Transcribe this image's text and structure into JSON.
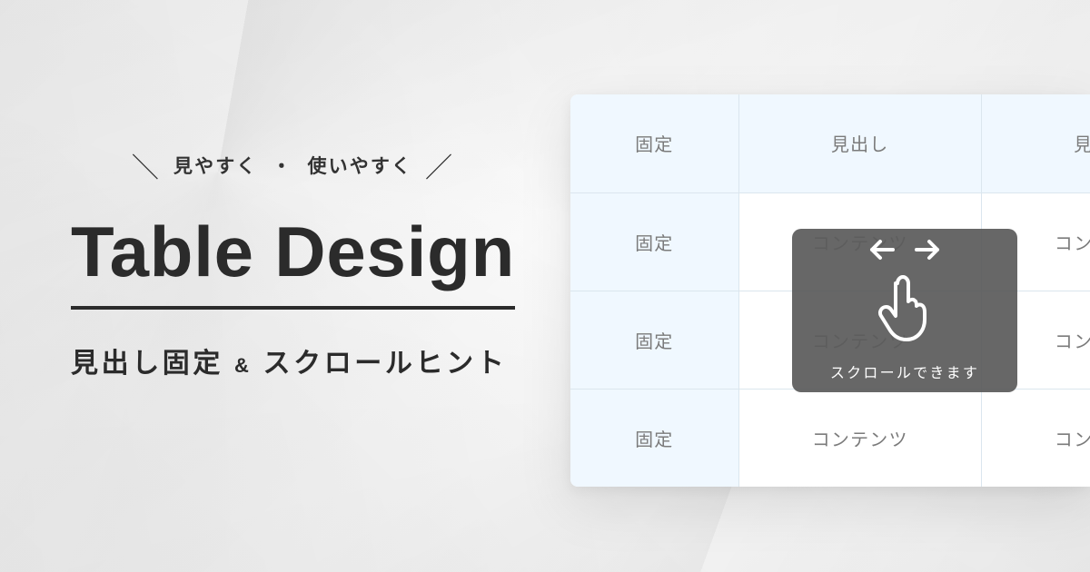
{
  "tagline": {
    "left_slash": "＼",
    "text_a": "見やすく",
    "dot": "・",
    "text_b": "使いやすく",
    "right_slash": "／"
  },
  "main_title": "Table Design",
  "subtitle": {
    "part_a": "見出し固定",
    "amp": "&",
    "part_b": "スクロールヒント"
  },
  "table": {
    "fixed_label": "固定",
    "heading_label": "見出し",
    "content_label": "コンテンツ",
    "columns": [
      "固定",
      "見出し",
      "見出し"
    ],
    "rows": [
      [
        "固定",
        "コンテンツ",
        "コンテンツ"
      ],
      [
        "固定",
        "コンテンツ",
        "コンテンツ"
      ],
      [
        "固定",
        "コンテンツ",
        "コンテンツ"
      ]
    ]
  },
  "hint": {
    "label": "スクロールできます"
  },
  "colors": {
    "text_dark": "#2b2b2b",
    "text_muted": "#7b7b7b",
    "table_header_bg": "#f0f8ff",
    "table_border": "#dbe6ee",
    "hint_bg": "rgba(90,90,90,0.92)"
  }
}
